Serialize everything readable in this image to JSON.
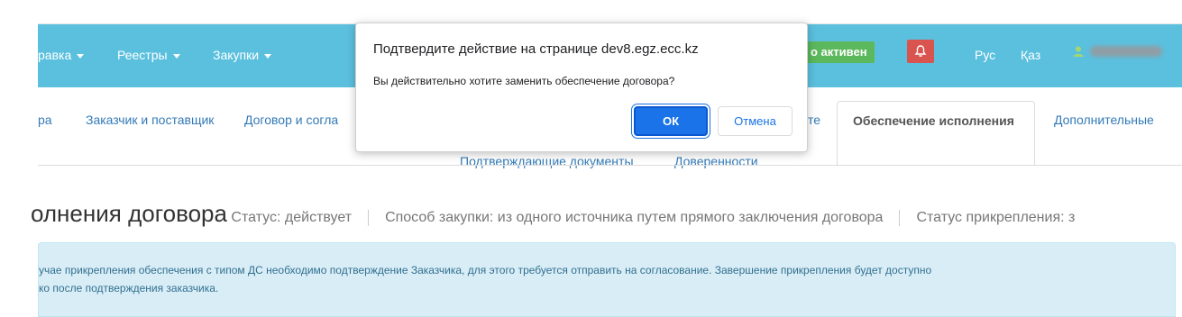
{
  "navbar": {
    "items": [
      {
        "label": "равка"
      },
      {
        "label": "Реестры"
      },
      {
        "label": "Закупки"
      }
    ],
    "status_badge": "о активен",
    "lang_ru": "Рус",
    "lang_kz": "Қаз",
    "colors": {
      "navbar_bg": "#5bc0de",
      "badge_bg": "#5cb85c",
      "bell_bg": "#d9534f"
    }
  },
  "tabs": {
    "row1": [
      "ра",
      "Заказчик и поставщик",
      "Договор и согла",
      "те"
    ],
    "active": "Обеспечение исполнения",
    "after_active": "Дополнительные",
    "row2": [
      "Подтверждающие документы",
      "Доверенности"
    ]
  },
  "heading": {
    "title": "олнения договора",
    "status": "Статус: действует",
    "method": "Способ закупки: из одного источника путем прямого заключения договора",
    "attach_status": "Статус прикрепления: з"
  },
  "alert": {
    "line1": "учае прикрепления обеспечения с типом ДС необходимо подтверждение Заказчика, для этого требуется отправить на согласование. Завершение прикрепления будет доступно",
    "line2": "ко после подтверждения заказчика."
  },
  "dialog": {
    "title": "Подтвердите действие на странице dev8.egz.ecc.kz",
    "message": "Вы действительно хотите заменить обеспечение договора?",
    "ok_label": "ОК",
    "cancel_label": "Отмена"
  }
}
